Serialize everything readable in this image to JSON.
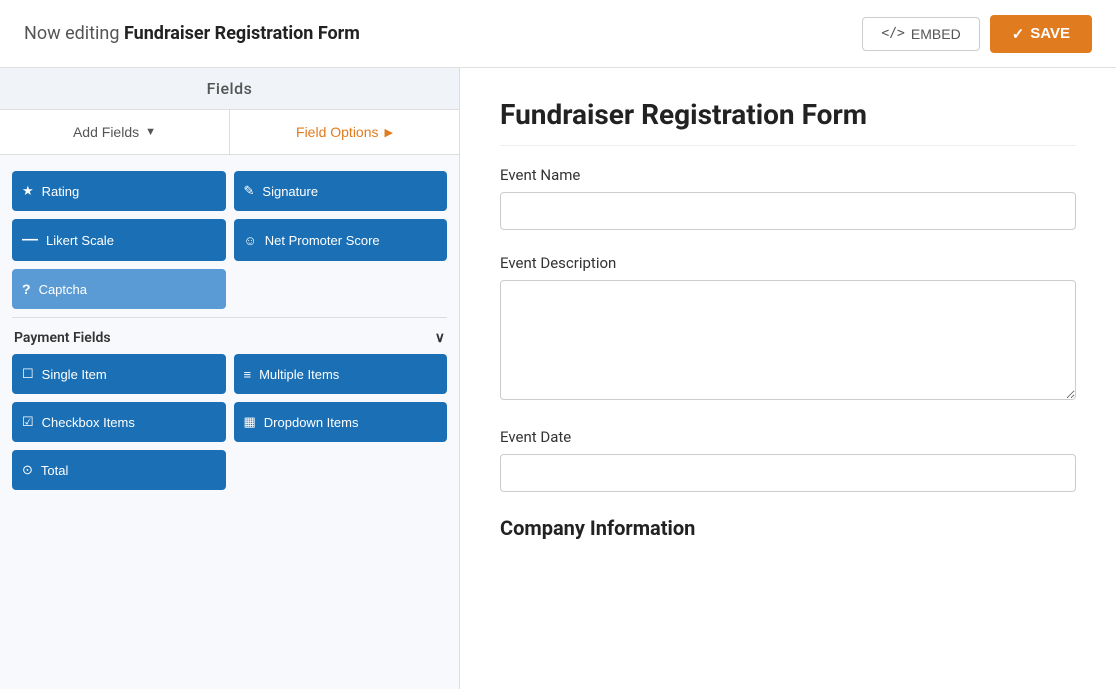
{
  "header": {
    "editing_prefix": "Now editing",
    "form_name": "Fundraiser Registration Form",
    "embed_label": "EMBED",
    "save_label": "SAVE"
  },
  "tabs_bar": {
    "label": "Fields"
  },
  "left_panel": {
    "add_fields_tab": "Add Fields",
    "field_options_tab": "Field Options",
    "field_buttons_row1": [
      {
        "id": "rating",
        "icon": "★",
        "label": "Rating"
      },
      {
        "id": "signature",
        "icon": "✎",
        "label": "Signature"
      }
    ],
    "field_buttons_row2": [
      {
        "id": "likert-scale",
        "icon": "—",
        "label": "Likert Scale"
      },
      {
        "id": "net-promoter-score",
        "icon": "☺",
        "label": "Net Promoter Score"
      }
    ],
    "field_buttons_row3": [
      {
        "id": "captcha",
        "icon": "?",
        "label": "Captcha"
      }
    ],
    "payment_section": "Payment Fields",
    "payment_buttons_row1": [
      {
        "id": "single-item",
        "icon": "☐",
        "label": "Single Item"
      },
      {
        "id": "multiple-items",
        "icon": "≡",
        "label": "Multiple Items"
      }
    ],
    "payment_buttons_row2": [
      {
        "id": "checkbox-items",
        "icon": "☑",
        "label": "Checkbox Items"
      },
      {
        "id": "dropdown-items",
        "icon": "▦",
        "label": "Dropdown Items"
      }
    ],
    "payment_buttons_row3": [
      {
        "id": "total",
        "icon": "⊙",
        "label": "Total"
      }
    ]
  },
  "form_preview": {
    "title": "Fundraiser Registration Form",
    "fields": [
      {
        "id": "event-name",
        "label": "Event Name",
        "type": "input",
        "placeholder": ""
      },
      {
        "id": "event-description",
        "label": "Event Description",
        "type": "textarea",
        "placeholder": ""
      },
      {
        "id": "event-date",
        "label": "Event Date",
        "type": "input",
        "placeholder": ""
      }
    ],
    "section_heading": "Company Information"
  }
}
